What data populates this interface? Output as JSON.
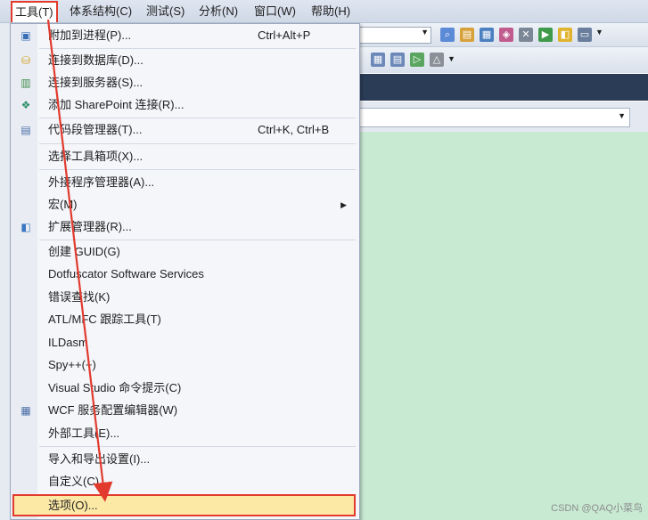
{
  "menubar": {
    "items": [
      {
        "label": "工具(T)"
      },
      {
        "label": "体系结构(C)"
      },
      {
        "label": "测试(S)"
      },
      {
        "label": "分析(N)"
      },
      {
        "label": "窗口(W)"
      },
      {
        "label": "帮助(H)"
      }
    ]
  },
  "tools_menu": {
    "items": [
      {
        "label": "附加到进程(P)...",
        "shortcut": "Ctrl+Alt+P"
      },
      {
        "label": "连接到数据库(D)..."
      },
      {
        "label": "连接到服务器(S)..."
      },
      {
        "label": "添加 SharePoint 连接(R)..."
      },
      {
        "label": "代码段管理器(T)...",
        "shortcut": "Ctrl+K, Ctrl+B"
      },
      {
        "label": "选择工具箱项(X)..."
      },
      {
        "label": "外接程序管理器(A)..."
      },
      {
        "label": "宏(M)"
      },
      {
        "label": "扩展管理器(R)..."
      },
      {
        "label": "创建 GUID(G)"
      },
      {
        "label": "Dotfuscator Software Services"
      },
      {
        "label": "错误查找(K)"
      },
      {
        "label": "ATL/MFC 跟踪工具(T)"
      },
      {
        "label": "ILDasm"
      },
      {
        "label": "Spy++(+)"
      },
      {
        "label": "Visual Studio 命令提示(C)"
      },
      {
        "label": "WCF 服务配置编辑器(W)"
      },
      {
        "label": "外部工具(E)..."
      },
      {
        "label": "导入和导出设置(I)..."
      },
      {
        "label": "自定义(C)..."
      },
      {
        "label": "选项(O)..."
      }
    ]
  },
  "watermark": "CSDN @QAQ小菜鸟",
  "colors": {
    "highlight_border": "#e23b2e",
    "editor_background": "#c8ead2",
    "menu_background": "#f4f6fa"
  }
}
